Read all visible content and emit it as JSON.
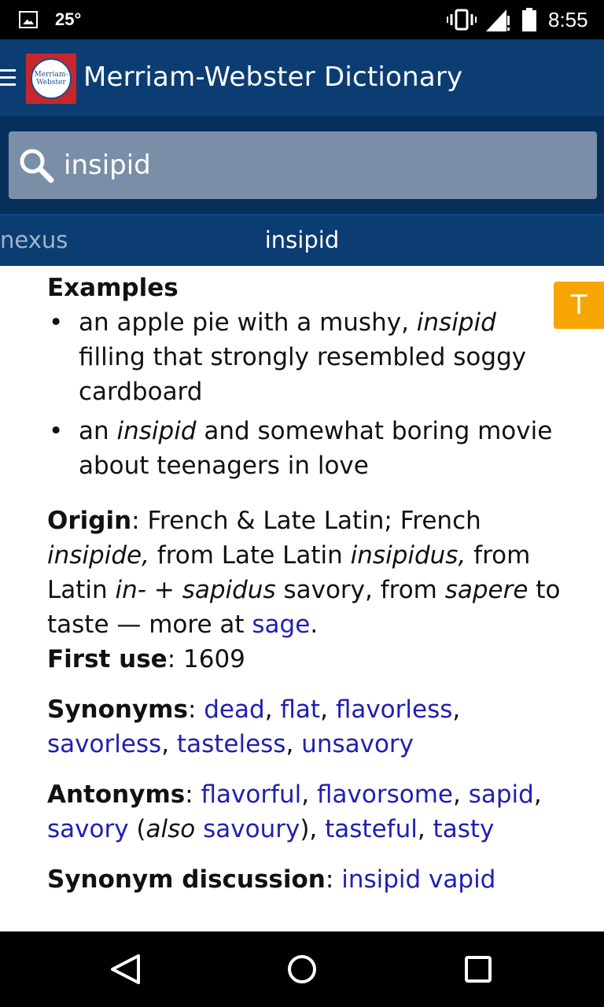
{
  "status_bar": {
    "temperature": "25°",
    "time": "8:55"
  },
  "app_bar": {
    "title": "Merriam-Webster Dictionary",
    "logo_line1": "Merriam-",
    "logo_line2": "Webster"
  },
  "search": {
    "value": "insipid",
    "placeholder": ""
  },
  "word_nav": {
    "previous": "nexus",
    "current": "insipid"
  },
  "content": {
    "examples_heading": "Examples",
    "example1_part1": "an apple pie with a mushy, ",
    "example1_italic": "insipid",
    "example1_part2": " filling that strongly resembled soggy cardboard",
    "example2_part1": "an ",
    "example2_italic": "insipid",
    "example2_part2": " and somewhat boring movie about teenagers in love",
    "origin_label": "Origin",
    "origin_t1": ": French & Late Latin; French ",
    "origin_i1": "insipide,",
    "origin_t2": " from Late Latin ",
    "origin_i2": "insipidus,",
    "origin_t3": " from Latin ",
    "origin_i3": "in-",
    "origin_t4": " + ",
    "origin_i4": "sapidus",
    "origin_t5": " savory, from ",
    "origin_i5": "sapere",
    "origin_t6": " to taste — more at ",
    "origin_link": "sage",
    "origin_t7": ".",
    "first_use_label": "First use",
    "first_use_value": ": 1609",
    "synonyms_label": "Synonyms",
    "synonyms": [
      "dead",
      "flat",
      "flavorless",
      "savorless",
      "tasteless",
      "unsavory"
    ],
    "antonyms_label": "Antonyms",
    "antonyms_a": [
      "flavorful",
      "flavorsome",
      "sapid",
      "savory"
    ],
    "antonym_also": "also",
    "antonym_savoury": "savoury",
    "antonyms_b": [
      "tasteful",
      "tasty"
    ],
    "syn_disc_label": "Synonym discussion",
    "syn_disc_link": "insipid vapid"
  },
  "translate_button": "T",
  "colors": {
    "app_bar": "#0b3d73",
    "link": "#1f1fb0",
    "translate": "#f7a500"
  }
}
